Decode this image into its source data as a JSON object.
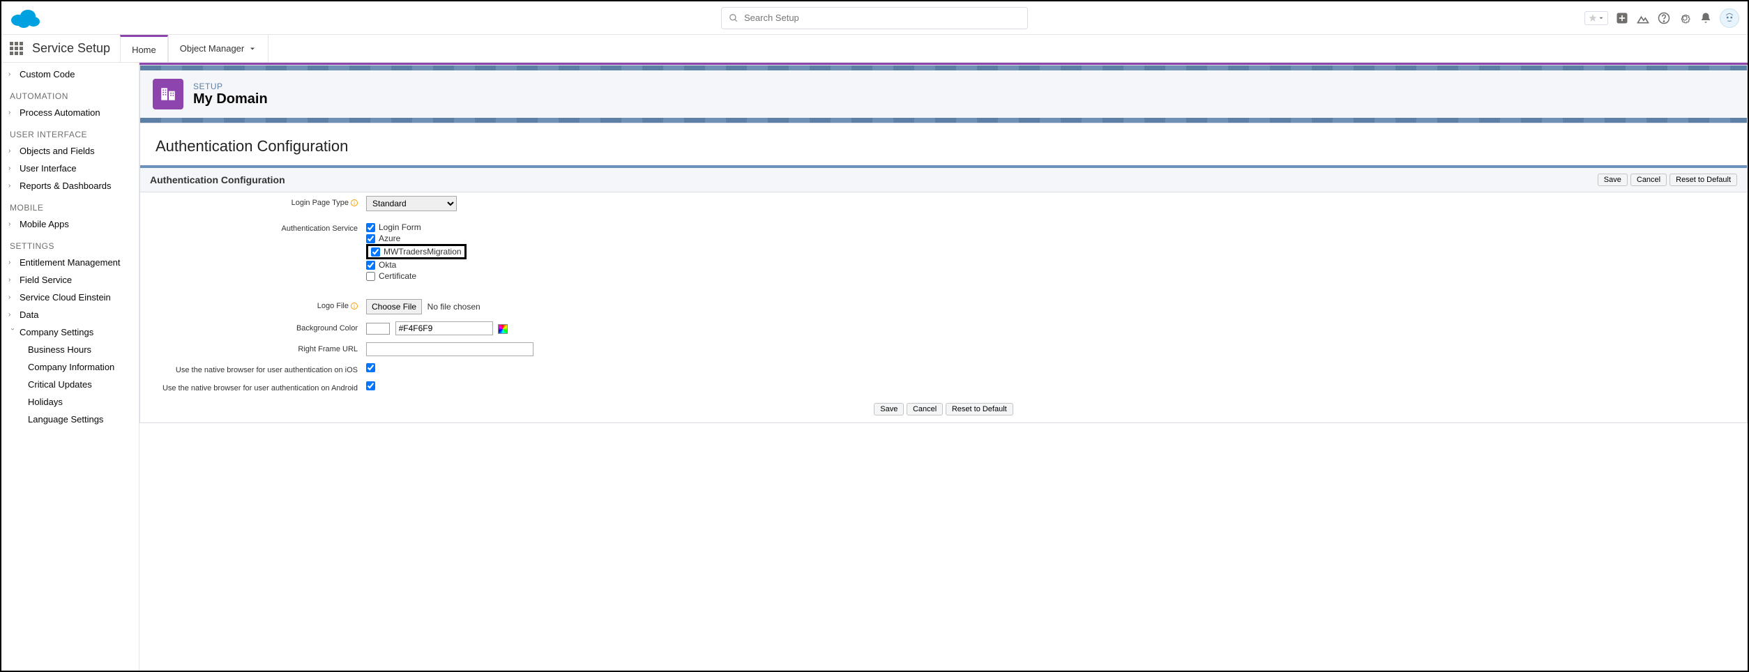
{
  "header": {
    "search_placeholder": "Search Setup"
  },
  "nav": {
    "app_name": "Service Setup",
    "tabs": [
      {
        "label": "Home",
        "active": true
      },
      {
        "label": "Object Manager",
        "active": false
      }
    ]
  },
  "sidebar": {
    "top_items": [
      {
        "label": "Custom Code",
        "arrow": ">"
      }
    ],
    "automation_header": "AUTOMATION",
    "automation_items": [
      {
        "label": "Process Automation",
        "arrow": ">"
      }
    ],
    "ui_header": "USER INTERFACE",
    "ui_items": [
      {
        "label": "Objects and Fields",
        "arrow": ">"
      },
      {
        "label": "User Interface",
        "arrow": ">"
      },
      {
        "label": "Reports & Dashboards",
        "arrow": ">"
      }
    ],
    "mobile_header": "MOBILE",
    "mobile_items": [
      {
        "label": "Mobile Apps",
        "arrow": ">"
      }
    ],
    "settings_header": "SETTINGS",
    "settings_items": [
      {
        "label": "Entitlement Management",
        "arrow": ">"
      },
      {
        "label": "Field Service",
        "arrow": ">"
      },
      {
        "label": "Service Cloud Einstein",
        "arrow": ">"
      },
      {
        "label": "Data",
        "arrow": ">"
      }
    ],
    "company_settings": {
      "label": "Company Settings",
      "arrow": "v",
      "children": [
        "Business Hours",
        "Company Information",
        "Critical Updates",
        "Holidays",
        "Language Settings"
      ]
    }
  },
  "page": {
    "eyebrow": "SETUP",
    "title": "My Domain",
    "section_title": "Authentication Configuration",
    "panel_title": "Authentication Configuration",
    "buttons": {
      "save": "Save",
      "cancel": "Cancel",
      "reset": "Reset to Default"
    },
    "form": {
      "login_page_type_label": "Login Page Type",
      "login_page_type_value": "Standard",
      "auth_service_label": "Authentication Service",
      "auth_services": [
        {
          "label": "Login Form",
          "checked": true
        },
        {
          "label": "Azure",
          "checked": true
        },
        {
          "label": "MWTradersMigration",
          "checked": true,
          "highlight": true
        },
        {
          "label": "Okta",
          "checked": true
        },
        {
          "label": "Certificate",
          "checked": false
        }
      ],
      "logo_file_label": "Logo File",
      "choose_file": "Choose File",
      "no_file": "No file chosen",
      "bg_color_label": "Background Color",
      "bg_color_value": "#F4F6F9",
      "right_frame_label": "Right Frame URL",
      "right_frame_value": "",
      "ios_label": "Use the native browser for user authentication on iOS",
      "ios_checked": true,
      "android_label": "Use the native browser for user authentication on Android",
      "android_checked": true
    }
  }
}
